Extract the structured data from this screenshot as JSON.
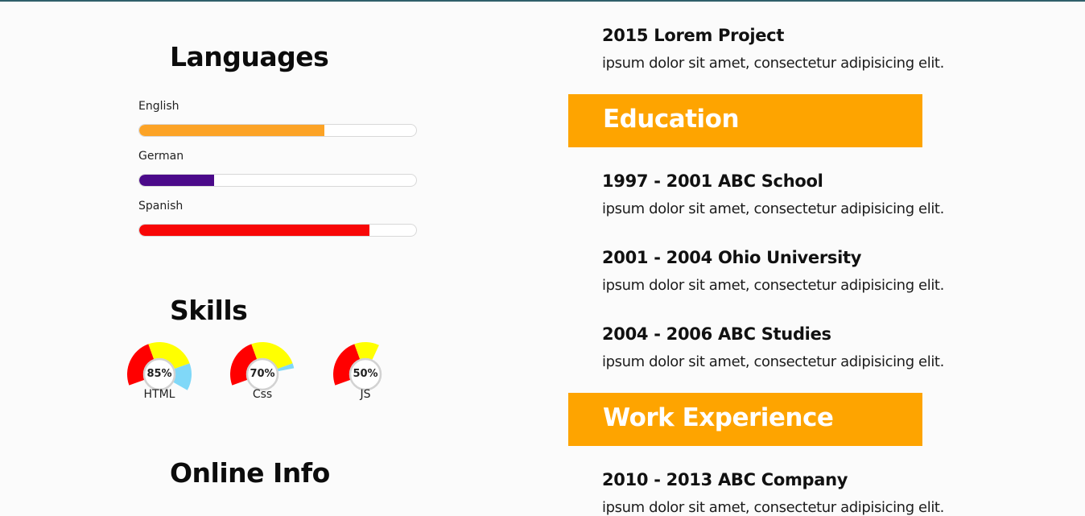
{
  "theme": {
    "accent": "#fea400",
    "page_bg": "#fbfbfb"
  },
  "languages": {
    "title": "Languages",
    "items": [
      {
        "label": "English",
        "level_percent": 67,
        "color": "#fca326"
      },
      {
        "label": "German",
        "level_percent": 27,
        "color": "#4b0a8a"
      },
      {
        "label": "Spanish",
        "level_percent": 83,
        "color": "#f80707"
      }
    ]
  },
  "skills": {
    "title": "Skills",
    "items": [
      {
        "label": "HTML",
        "value": "85%",
        "level_percent": 85
      },
      {
        "label": "Css",
        "value": "70%",
        "level_percent": 70
      },
      {
        "label": "JS",
        "value": "50%",
        "level_percent": 50
      }
    ],
    "gauge_colors": [
      "#ff0000",
      "#ffff00",
      "#80d8f8"
    ]
  },
  "online_info": {
    "title": "Online Info"
  },
  "projects": {
    "items": [
      {
        "title": "2015 Lorem Project",
        "description": "ipsum dolor sit amet, consectetur adipisicing elit."
      }
    ]
  },
  "education": {
    "title": "Education",
    "items": [
      {
        "title": "1997 - 2001 ABC School",
        "description": "ipsum dolor sit amet, consectetur adipisicing elit."
      },
      {
        "title": "2001 - 2004 Ohio University",
        "description": "ipsum dolor sit amet, consectetur adipisicing elit."
      },
      {
        "title": "2004 - 2006 ABC Studies",
        "description": "ipsum dolor sit amet, consectetur adipisicing elit."
      }
    ]
  },
  "work_experience": {
    "title": "Work Experience",
    "items": [
      {
        "title": "2010 - 2013 ABC Company",
        "description": "ipsum dolor sit amet, consectetur adipisicing elit."
      }
    ]
  }
}
